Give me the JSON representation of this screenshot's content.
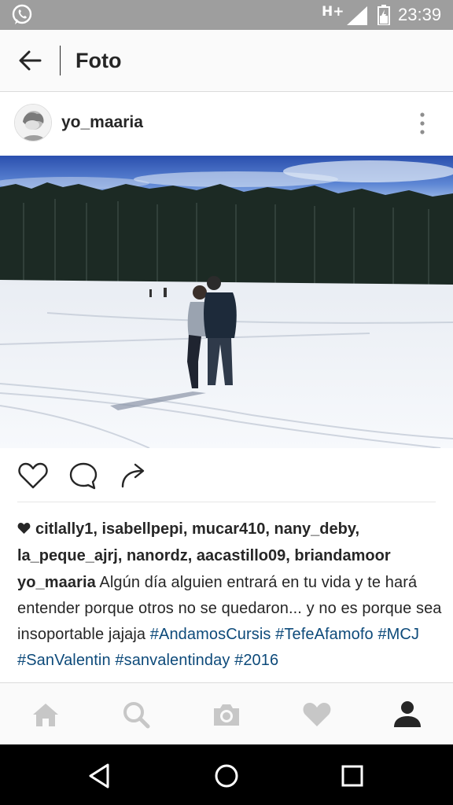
{
  "status_bar": {
    "network": "H+",
    "time": "23:39"
  },
  "header": {
    "title": "Foto",
    "back_icon": "arrow-left-icon"
  },
  "post": {
    "username": "yo_maaria",
    "more_icon": "vertical-dots-icon",
    "photo_description_icon": "photo",
    "actions": {
      "like_icon": "heart-outline-icon",
      "comment_icon": "comment-bubble-icon",
      "share_icon": "share-arrow-icon"
    },
    "likes": {
      "line1": "citlally1, isabellpepi, mucar410, nany_deby,",
      "line2": "la_peque_ajrj, nanordz, aacastillo09, briandamoor"
    },
    "caption": {
      "user": "yo_maaria",
      "text": "Algún día alguien entrará en tu vida y te hará entender porque otros no se quedaron... y no es porque sea insoportable jajaja",
      "tags": [
        "#AndamosCursis",
        "#TefeAfamofo",
        "#MCJ",
        "#SanValentin",
        "#sanvalentinday",
        "#2016"
      ]
    }
  },
  "tab_bar": {
    "items": [
      "home-icon",
      "search-icon",
      "camera-icon",
      "heart-icon",
      "profile-icon"
    ]
  },
  "nav_bar": {
    "items": [
      "back-triangle-icon",
      "home-circle-icon",
      "recents-square-icon"
    ]
  },
  "colors": {
    "status_bar": "#9e9e9e",
    "hashtag": "#0d4a7a",
    "text": "#262626",
    "tab_inactive": "#c7c7c7"
  }
}
